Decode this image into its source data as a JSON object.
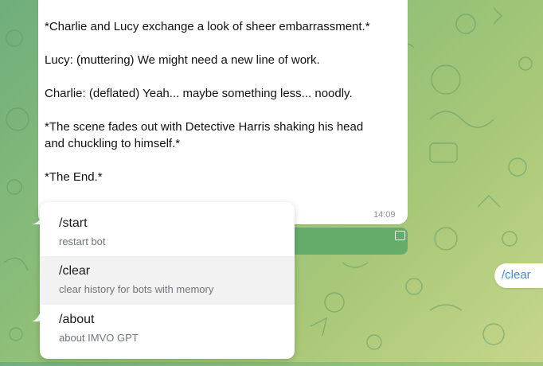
{
  "message": {
    "lines": [
      "*Charlie and Lucy exchange a look of sheer embarrassment.*",
      "Lucy: (muttering) We might need a new line of work.",
      "Charlie: (deflated) Yeah... maybe something less... noodly.",
      "*The scene fades out with Detective Harris shaking his head",
      "and chuckling to himself.*",
      "*The End.*"
    ],
    "time": "14:09"
  },
  "commands": [
    {
      "command": "/start",
      "description": "restart bot"
    },
    {
      "command": "/clear",
      "description": "clear history for bots with memory"
    },
    {
      "command": "/about",
      "description": "about IMVO GPT"
    }
  ],
  "selected_command": "/clear",
  "reply_chip": {
    "label": "/clear"
  },
  "colors": {
    "accent": "#3390ec",
    "bubble": "#ffffff",
    "green_bar": "#5fa96a"
  }
}
